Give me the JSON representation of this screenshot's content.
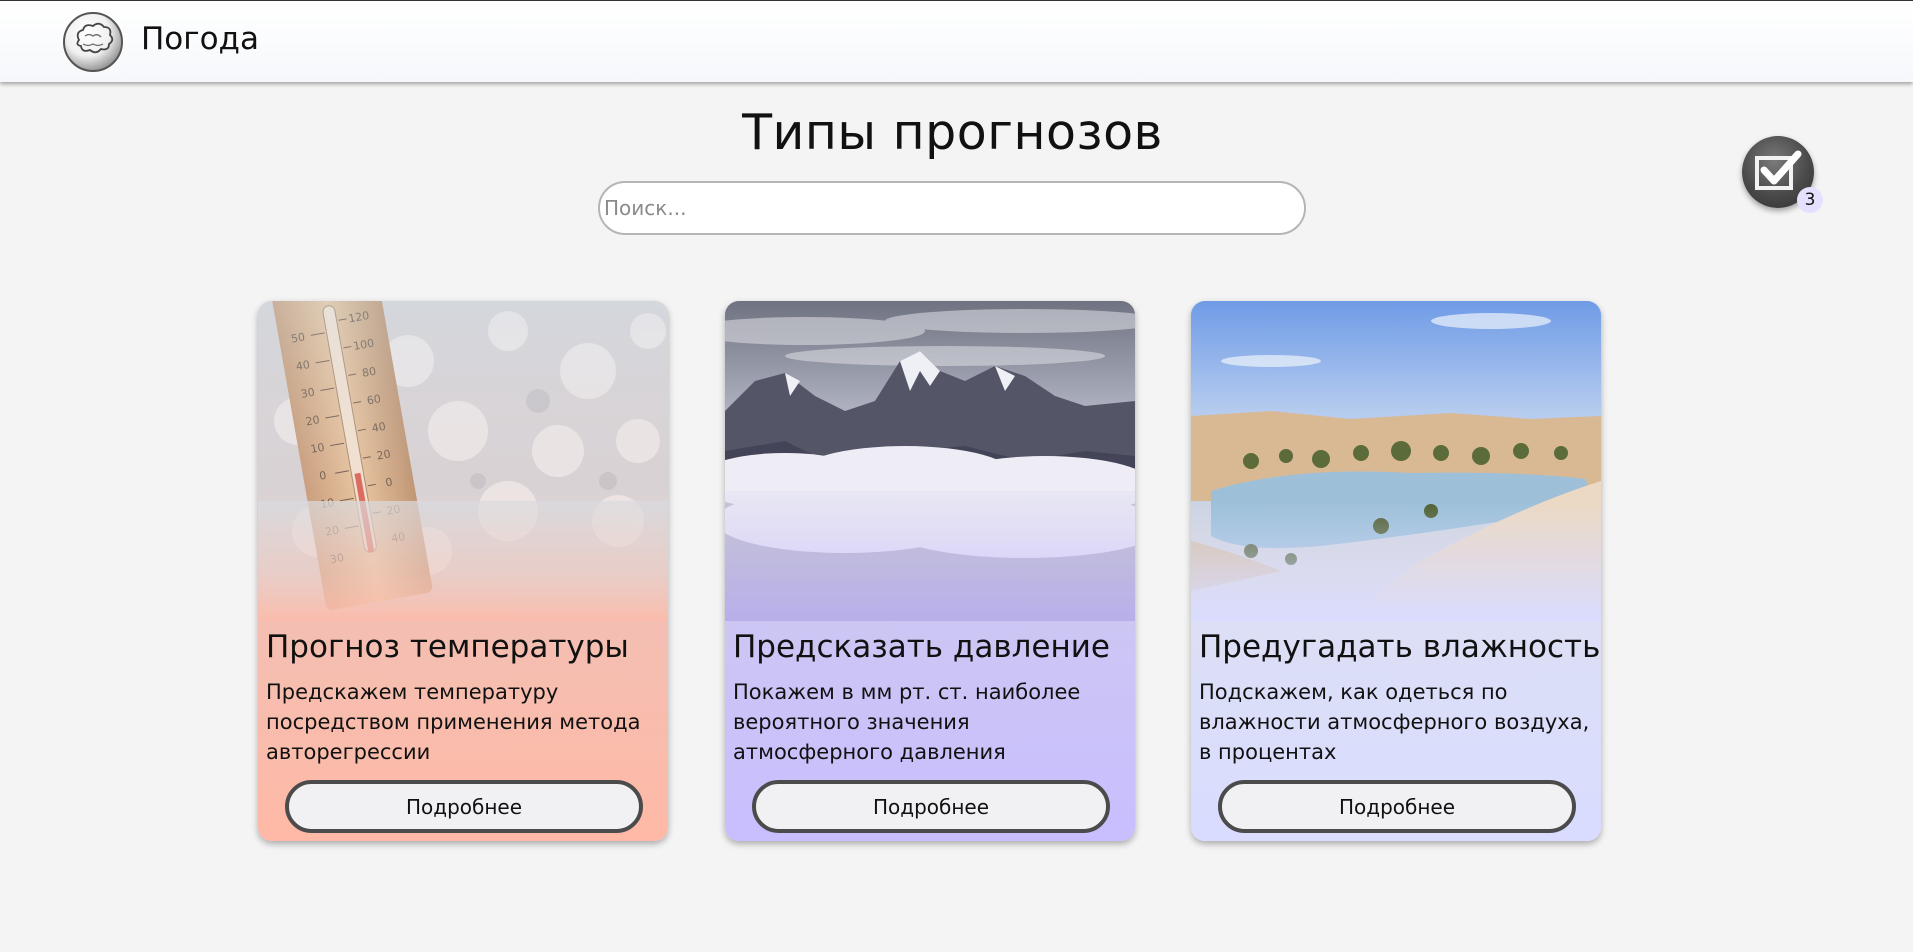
{
  "header": {
    "app_title": "Погода",
    "logo_icon": "weather-logo-icon"
  },
  "main": {
    "title": "Типы прогнозов",
    "search": {
      "placeholder": "Поиск...",
      "value": ""
    }
  },
  "checklist": {
    "icon": "checkbox-icon",
    "count": "3"
  },
  "cards": [
    {
      "image": "thermometer-in-snow-image",
      "title": "Прогноз температуры",
      "description": "Предскажем температуру посредством применения метода авторегрессии",
      "button_label": "Подробнее"
    },
    {
      "image": "mountains-above-clouds-image",
      "title": "Предсказать давление",
      "description": "Покажем в мм рт. ст. наиболее вероятного значения атмосферного давления",
      "button_label": "Подробнее"
    },
    {
      "image": "desert-oasis-image",
      "title": "Предугадать влажность",
      "description": "Подскажем, как одеться по влажности атмосферного воздуха, в процентах",
      "button_label": "Подробнее"
    }
  ],
  "colors": {
    "background": "#f4f4f4",
    "card_temperature": "#ffb9a6",
    "card_pressure": "#c9beff",
    "card_humidity": "#d9dcff",
    "button_border": "#4b4b4b"
  }
}
